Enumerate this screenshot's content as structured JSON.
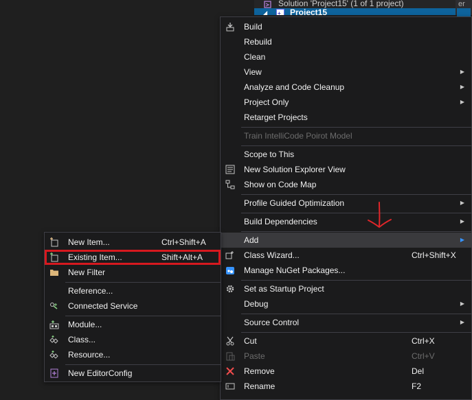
{
  "solution_explorer": {
    "solution_label": "Solution 'Project15' (1 of 1 project)",
    "project_label": "Project15",
    "right_edge_text": "er"
  },
  "context_menu": {
    "items": [
      {
        "label": "Build",
        "icon": "build-icon"
      },
      {
        "label": "Rebuild"
      },
      {
        "label": "Clean"
      },
      {
        "label": "View",
        "submenu": true
      },
      {
        "label": "Analyze and Code Cleanup",
        "submenu": true
      },
      {
        "label": "Project Only",
        "submenu": true
      },
      {
        "label": "Retarget Projects"
      },
      {
        "label": "Train IntelliCode Poirot Model",
        "disabled": true
      },
      {
        "label": "Scope to This"
      },
      {
        "label": "New Solution Explorer View",
        "icon": "new-view-icon"
      },
      {
        "label": "Show on Code Map",
        "icon": "code-map-icon"
      },
      {
        "label": "Profile Guided Optimization",
        "submenu": true
      },
      {
        "label": "Build Dependencies",
        "submenu": true
      },
      {
        "label": "Add",
        "submenu": true,
        "highlighted": true
      },
      {
        "label": "Class Wizard...",
        "shortcut": "Ctrl+Shift+X",
        "icon": "class-wizard-icon"
      },
      {
        "label": "Manage NuGet Packages...",
        "icon": "nuget-icon"
      },
      {
        "label": "Set as Startup Project",
        "icon": "gear-icon"
      },
      {
        "label": "Debug",
        "submenu": true
      },
      {
        "label": "Source Control",
        "submenu": true
      },
      {
        "label": "Cut",
        "shortcut": "Ctrl+X",
        "icon": "scissors-icon"
      },
      {
        "label": "Paste",
        "shortcut": "Ctrl+V",
        "icon": "paste-icon",
        "disabled": true
      },
      {
        "label": "Remove",
        "shortcut": "Del",
        "icon": "close-icon"
      },
      {
        "label": "Rename",
        "shortcut": "F2",
        "icon": "rename-icon"
      }
    ]
  },
  "add_submenu": {
    "items": [
      {
        "label": "New Item...",
        "shortcut": "Ctrl+Shift+A",
        "icon": "new-item-icon"
      },
      {
        "label": "Existing Item...",
        "shortcut": "Shift+Alt+A",
        "icon": "existing-item-icon",
        "boxed": true
      },
      {
        "label": "New Filter",
        "icon": "folder-icon"
      },
      {
        "label": "Reference..."
      },
      {
        "label": "Connected Service",
        "icon": "connected-service-icon"
      },
      {
        "label": "Module...",
        "icon": "module-icon"
      },
      {
        "label": "Class...",
        "icon": "class-icon"
      },
      {
        "label": "Resource...",
        "icon": "resource-icon"
      },
      {
        "label": "New EditorConfig",
        "icon": "editorconfig-icon"
      }
    ]
  },
  "colors": {
    "highlight_box": "#d7191f",
    "annotation_arrow": "#e0262a",
    "selection_blue": "#0e639c"
  }
}
